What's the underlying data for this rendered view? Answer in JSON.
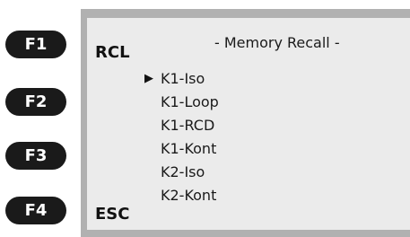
{
  "function_keys": [
    {
      "label": "F1"
    },
    {
      "label": "F2"
    },
    {
      "label": "F3"
    },
    {
      "label": "F4"
    }
  ],
  "screen": {
    "title": "- Memory Recall -",
    "softkeys": {
      "f1": "RCL",
      "f4": "ESC"
    },
    "cursor_glyph": "▶",
    "selected_index": 0,
    "items": [
      {
        "label": "K1-Iso"
      },
      {
        "label": "K1-Loop"
      },
      {
        "label": "K1-RCD"
      },
      {
        "label": "K1-Kont"
      },
      {
        "label": "K2-Iso"
      },
      {
        "label": "K2-Kont"
      }
    ]
  },
  "colors": {
    "key_background": "#1a1a1a",
    "bezel": "#b1b1b1",
    "display": "#ebebeb"
  }
}
